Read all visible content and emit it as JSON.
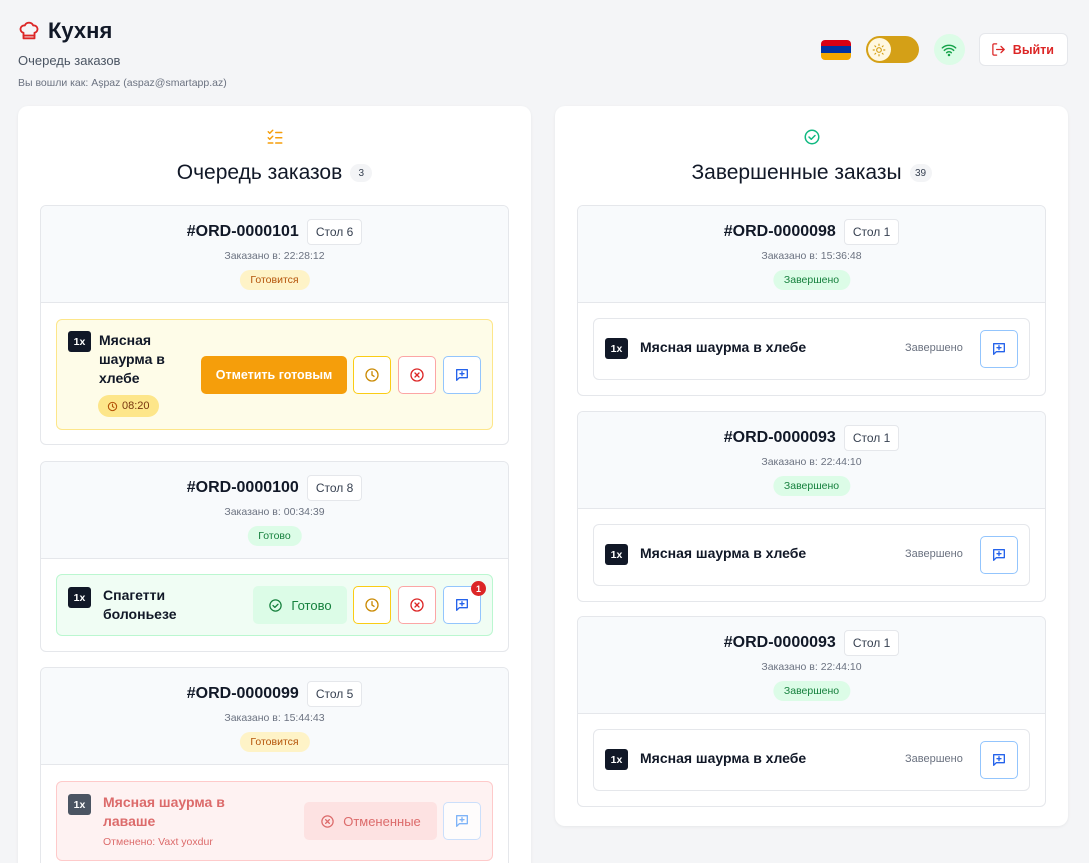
{
  "header": {
    "title": "Кухня",
    "subtitle": "Очередь заказов",
    "login_info": "Вы вошли как: Aşpaz (aspaz@smartapp.az)",
    "logout_label": "Выйти"
  },
  "queue": {
    "title": "Очередь заказов",
    "count": "3",
    "orders": [
      {
        "id": "#ORD-0000101",
        "table": "Стол 6",
        "time": "Заказано в: 22:28:12",
        "status": "Готовится",
        "item": {
          "qty": "1x",
          "name": "Мясная шаурма в хлебе",
          "timer": "08:20",
          "action": "Отметить готовым"
        }
      },
      {
        "id": "#ORD-0000100",
        "table": "Стол 8",
        "time": "Заказано в: 00:34:39",
        "status": "Готово",
        "item": {
          "qty": "1x",
          "name": "Спагетти болоньезе",
          "state_label": "Готово",
          "note_count": "1"
        }
      },
      {
        "id": "#ORD-0000099",
        "table": "Стол 5",
        "time": "Заказано в: 15:44:43",
        "status": "Готовится",
        "item": {
          "qty": "1x",
          "name": "Мясная шаурма в лаваше",
          "state_label": "Отмененные",
          "cancel_reason": "Отменено: Vaxt yoxdur"
        }
      }
    ]
  },
  "completed": {
    "title": "Завершенные заказы",
    "count": "39",
    "orders": [
      {
        "id": "#ORD-0000098",
        "table": "Стол 1",
        "time": "Заказано в: 15:36:48",
        "status": "Завершено",
        "item": {
          "qty": "1x",
          "name": "Мясная шаурма в хлебе",
          "status": "Завершено"
        }
      },
      {
        "id": "#ORD-0000093",
        "table": "Стол 1",
        "time": "Заказано в: 22:44:10",
        "status": "Завершено",
        "item": {
          "qty": "1x",
          "name": "Мясная шаурма в хлебе",
          "status": "Завершено"
        }
      },
      {
        "id": "#ORD-0000093",
        "table": "Стол 1",
        "time": "Заказано в: 22:44:10",
        "status": "Завершено",
        "item": {
          "qty": "1x",
          "name": "Мясная шаурма в хлебе",
          "status": "Завершено"
        }
      }
    ]
  },
  "icons": {
    "brand": "chef-hat-icon",
    "language": "armenian-flag-icon",
    "theme": "sun-icon",
    "connection": "wifi-icon",
    "logout": "logout-icon",
    "queue": "checklist-icon",
    "completed": "check-circle-icon",
    "timer": "clock-icon",
    "cancel": "x-circle-icon",
    "note": "message-plus-icon"
  },
  "colors": {
    "accent": "#f59e0b",
    "danger": "#dc2626",
    "success": "#15803d",
    "flag": [
      "#d90012",
      "#0033a0",
      "#f2a800"
    ]
  }
}
